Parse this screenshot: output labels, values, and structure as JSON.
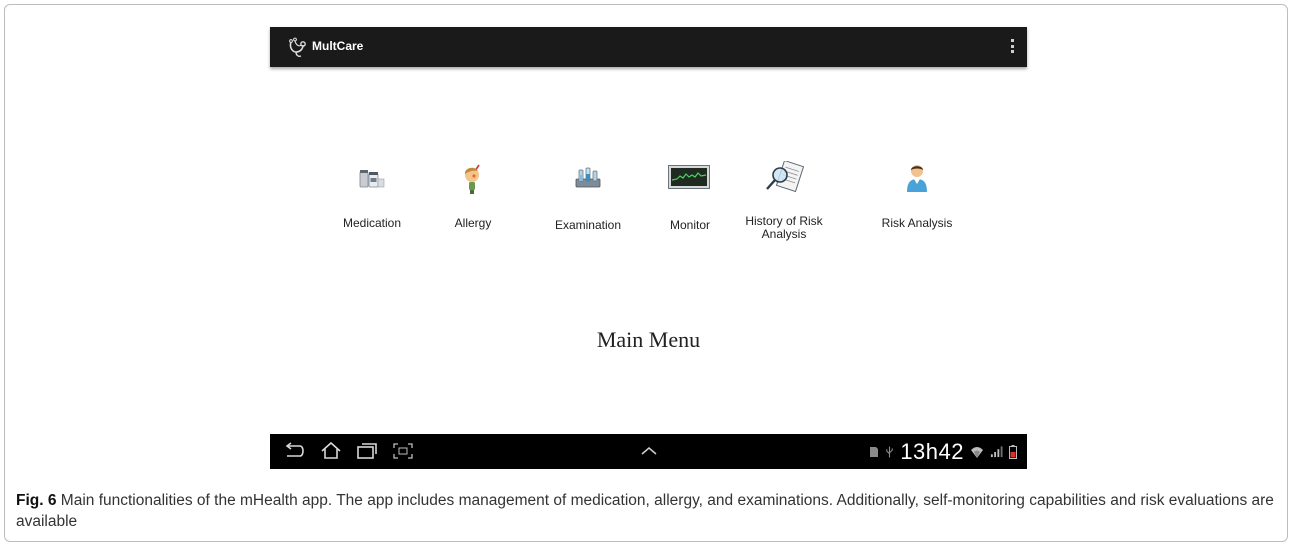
{
  "app": {
    "title": "MultCare"
  },
  "menu": [
    {
      "label": "Medication",
      "icon": "medication-icon"
    },
    {
      "label": "Allergy",
      "icon": "allergy-icon"
    },
    {
      "label": "Examination",
      "icon": "examination-icon"
    },
    {
      "label": "Monitor",
      "icon": "monitor-icon"
    },
    {
      "label": "History of Risk Analysis",
      "icon": "history-of-risk-analysis-icon"
    },
    {
      "label": "Risk Analysis",
      "icon": "risk-analysis-icon"
    }
  ],
  "main_title": "Main Menu",
  "navbar": {
    "clock": "13h42"
  },
  "caption": {
    "label": "Fig. 6",
    "text": " Main functionalities of the mHealth app. The app includes management of medication, allergy, and examinations. Additionally, self-monitoring capabilities and risk evaluations are available"
  },
  "colors": {
    "action_bar": "#1a1a1a",
    "nav_bar": "#000000",
    "battery": "#d9302a"
  }
}
